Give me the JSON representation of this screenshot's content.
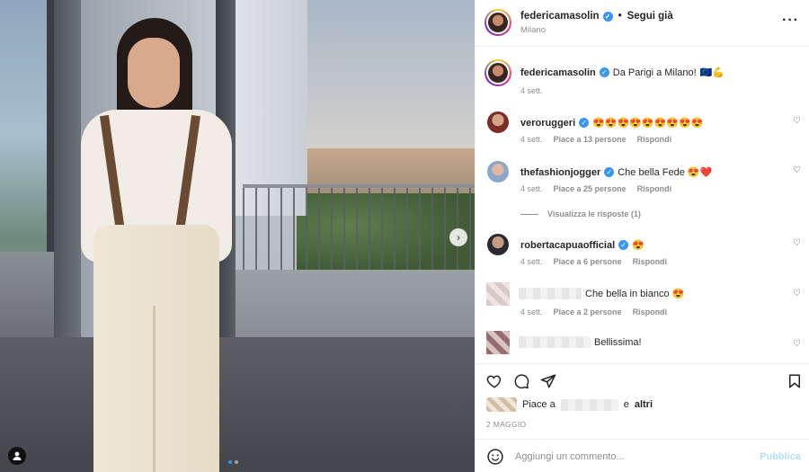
{
  "header": {
    "username": "federicamasolin",
    "separator": "•",
    "follow_label": "Segui già",
    "location": "Milano",
    "more_icon": "more-horizontal-icon"
  },
  "caption": {
    "username": "federicamasolin",
    "text": "Da Parigi a Milano!",
    "emoji": "🇪🇺💪",
    "time": "4 sett."
  },
  "comments": [
    {
      "username": "veroruggeri",
      "verified": true,
      "text": "😍😍😍😍😍😍😍😍😍",
      "time": "4 sett.",
      "likes": "Piace a 13 persone",
      "reply": "Rispondi"
    },
    {
      "username": "thefashionjogger",
      "verified": true,
      "text": "Che bella Fede 😍❤️",
      "time": "4 sett.",
      "likes": "Piace a 25 persone",
      "reply": "Rispondi",
      "view_replies": "Visualizza le risposte (1)"
    },
    {
      "username": "robertacapuaofficial",
      "verified": true,
      "text": "😍",
      "time": "4 sett.",
      "likes": "Piace a 6 persone",
      "reply": "Rispondi"
    },
    {
      "username": "",
      "verified": false,
      "text": "Che bella in bianco 😍",
      "time": "4 sett.",
      "likes": "Piace a 2 persone",
      "reply": "Rispondi"
    },
    {
      "username": "",
      "verified": false,
      "text": "Bellissima!"
    }
  ],
  "likes": {
    "prefix": "Piace a",
    "suffix": "e",
    "others": "altri"
  },
  "date": "2 MAGGIO",
  "composer": {
    "placeholder": "Aggiungi un commento...",
    "publish": "Pubblica"
  },
  "colors": {
    "accent": "#3897f0",
    "muted": "#8e8e8e",
    "publish_disabled": "#b2dffc"
  }
}
